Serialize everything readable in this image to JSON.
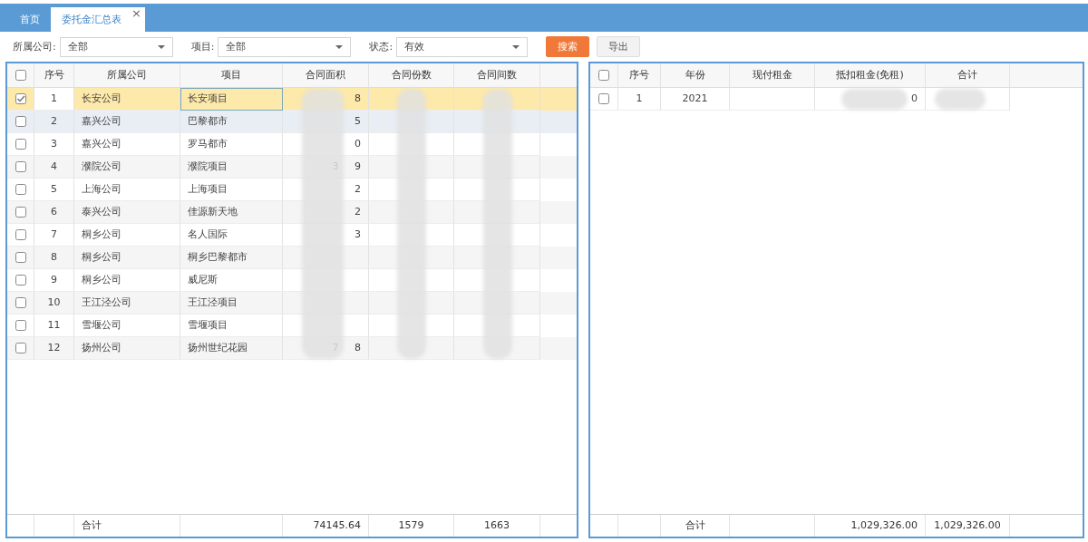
{
  "tabs": [
    {
      "label": "首页",
      "selected": false
    },
    {
      "label": "委托金汇总表",
      "selected": true,
      "close_glyph": "×"
    }
  ],
  "filters": [
    {
      "label": "所属公司:",
      "value": "全部"
    },
    {
      "label": "项目:",
      "value": "全部"
    },
    {
      "label": "状态:",
      "value": "有效"
    }
  ],
  "buttons": [
    {
      "label": "搜索",
      "kind": "primary"
    },
    {
      "label": "导出",
      "kind": "default"
    }
  ],
  "left_table": {
    "header_checked": false,
    "columns": [
      {
        "label": "序号"
      },
      {
        "label": "所属公司"
      },
      {
        "label": "项目"
      },
      {
        "label": "合同面积",
        "redacted": true
      },
      {
        "label": "合同份数",
        "redacted": true
      },
      {
        "label": "合同间数",
        "redacted": true
      }
    ],
    "rows": [
      {
        "checked": true,
        "selected": true,
        "hovered": false,
        "focused": true,
        "cells": [
          "1",
          "长安公司",
          "长安项目",
          "8"
        ]
      },
      {
        "checked": false,
        "selected": false,
        "hovered": true,
        "focused": false,
        "cells": [
          "2",
          "嘉兴公司",
          "巴黎都市",
          "5"
        ]
      },
      {
        "checked": false,
        "selected": false,
        "hovered": false,
        "focused": false,
        "cells": [
          "3",
          "嘉兴公司",
          "罗马都市",
          "0"
        ]
      },
      {
        "checked": false,
        "selected": false,
        "hovered": false,
        "focused": false,
        "cells": [
          "4",
          "濮院公司",
          "濮院项目",
          "3     9"
        ]
      },
      {
        "checked": false,
        "selected": false,
        "hovered": false,
        "focused": false,
        "cells": [
          "5",
          "上海公司",
          "上海项目",
          "2"
        ]
      },
      {
        "checked": false,
        "selected": false,
        "hovered": false,
        "focused": false,
        "cells": [
          "6",
          "泰兴公司",
          "佳源新天地",
          "2"
        ]
      },
      {
        "checked": false,
        "selected": false,
        "hovered": false,
        "focused": false,
        "cells": [
          "7",
          "桐乡公司",
          "名人国际",
          "3"
        ]
      },
      {
        "checked": false,
        "selected": false,
        "hovered": false,
        "focused": false,
        "cells": [
          "8",
          "桐乡公司",
          "桐乡巴黎都市"
        ]
      },
      {
        "checked": false,
        "selected": false,
        "hovered": false,
        "focused": false,
        "cells": [
          "9",
          "桐乡公司",
          "威尼斯"
        ]
      },
      {
        "checked": false,
        "selected": false,
        "hovered": false,
        "focused": false,
        "cells": [
          "10",
          "王江泾公司",
          "王江泾项目"
        ]
      },
      {
        "checked": false,
        "selected": false,
        "hovered": false,
        "focused": false,
        "cells": [
          "11",
          "雪堰公司",
          "雪堰项目"
        ]
      },
      {
        "checked": false,
        "selected": false,
        "hovered": false,
        "focused": false,
        "cells": [
          "12",
          "扬州公司",
          "扬州世纪花园",
          "7     8"
        ]
      }
    ],
    "footer": {
      "label": "合计",
      "values": [
        "74145.64",
        "1579",
        "1663"
      ]
    }
  },
  "right_table": {
    "header_checked": false,
    "columns": [
      {
        "label": "序号"
      },
      {
        "label": "年份"
      },
      {
        "label": "现付租金"
      },
      {
        "label": "抵扣租金(免租)",
        "redacted": true
      },
      {
        "label": "合计",
        "redacted": true
      }
    ],
    "rows": [
      {
        "checked": false,
        "selected": false,
        "hovered": false,
        "focused": false,
        "cells": [
          "1",
          "2021",
          null,
          "0"
        ]
      }
    ],
    "footer": {
      "label": "合计",
      "values": [
        "1,029,326.00",
        "1,029,326.00"
      ]
    }
  }
}
